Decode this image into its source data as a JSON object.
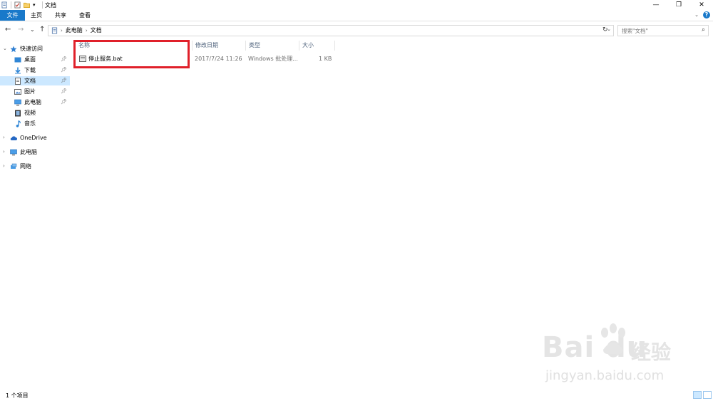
{
  "window": {
    "title": "文档",
    "minimize": "—",
    "restore": "❐",
    "close": "✕"
  },
  "ribbon": {
    "tabs": [
      "文件",
      "主页",
      "共享",
      "查看"
    ],
    "expand_icon": "chevron-down-icon",
    "help_label": "?"
  },
  "address": {
    "back": "←",
    "forward": "→",
    "recent": "⌄",
    "up": "↑",
    "breadcrumbs": [
      "此电脑",
      "文档"
    ],
    "refresh": "↻",
    "search_placeholder": "搜索\"文档\""
  },
  "nav": {
    "quick_access": "快速访问",
    "items": [
      {
        "label": "桌面",
        "icon": "desktop-icon",
        "pinned": true
      },
      {
        "label": "下载",
        "icon": "download-icon",
        "pinned": true
      },
      {
        "label": "文档",
        "icon": "document-icon",
        "pinned": true
      },
      {
        "label": "图片",
        "icon": "pictures-icon",
        "pinned": true
      },
      {
        "label": "此电脑",
        "icon": "computer-icon",
        "pinned": true
      },
      {
        "label": "视频",
        "icon": "video-icon",
        "pinned": false
      },
      {
        "label": "音乐",
        "icon": "music-icon",
        "pinned": false
      }
    ],
    "onedrive": "OneDrive",
    "this_pc": "此电脑",
    "network": "网络"
  },
  "columns": [
    "名称",
    "修改日期",
    "类型",
    "大小"
  ],
  "files": [
    {
      "name": "停止服务.bat",
      "modified": "2017/7/24 11:26",
      "type": "Windows 批处理...",
      "size": "1 KB"
    }
  ],
  "status": {
    "count": "1 个项目"
  },
  "watermark": {
    "logo": "Bai du",
    "cn": "经验",
    "url": "jingyan.baidu.com"
  },
  "colors": {
    "accent": "#1979ca",
    "selection": "#cce8ff",
    "highlight_box": "#e0202a"
  }
}
